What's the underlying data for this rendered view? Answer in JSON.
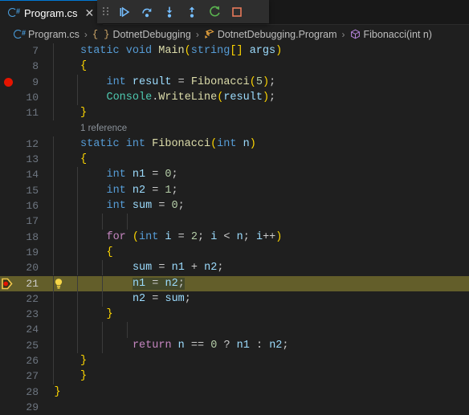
{
  "window": {
    "background": "#1f1f1f",
    "theme": "dark-plus"
  },
  "tab_bar": {
    "active_tab": {
      "label": "Program.cs",
      "icon": "csharp-file-icon",
      "close_label": "✕",
      "accent": "#0078d4"
    }
  },
  "debug_toolbar": {
    "drag_handle": "drag-handle-icon",
    "buttons": [
      {
        "name": "continue",
        "label": "Continue",
        "icon": "play-icon",
        "color": "#75beff"
      },
      {
        "name": "step-over",
        "label": "Step Over",
        "icon": "step-over-arc-icon",
        "color": "#75beff"
      },
      {
        "name": "step-into",
        "label": "Step Into",
        "icon": "step-into-down-arrow-icon",
        "color": "#75beff"
      },
      {
        "name": "step-out",
        "label": "Step Out",
        "icon": "step-out-up-arrow-icon",
        "color": "#75beff"
      },
      {
        "name": "restart",
        "label": "Restart",
        "icon": "restart-circular-arrow-icon",
        "color": "#5bb450"
      },
      {
        "name": "stop",
        "label": "Stop",
        "icon": "stop-square-icon",
        "color": "#e8795a"
      }
    ]
  },
  "breadcrumb": {
    "separator": "›",
    "items": [
      {
        "label": "Program.cs",
        "icon": "csharp-file-icon"
      },
      {
        "label": "DotnetDebugging",
        "icon": "namespace-braces-icon"
      },
      {
        "label": "DotnetDebugging.Program",
        "icon": "class-icon"
      },
      {
        "label": "Fibonacci(int n)",
        "icon": "method-cube-icon"
      }
    ]
  },
  "editor": {
    "language": "csharp",
    "first_visible_line": 7,
    "last_visible_line": 29,
    "current_execution_line": 21,
    "breakpoint_lines": [
      9,
      21
    ],
    "codelens": {
      "line": 12,
      "text": "1 reference"
    },
    "selection": {
      "line": 21,
      "text": "n1 = n2;"
    },
    "lightbulb_line": 21,
    "lines": [
      {
        "n": 7,
        "text": "    static void Main(string[] args)"
      },
      {
        "n": 8,
        "text": "    {"
      },
      {
        "n": 9,
        "text": "        int result = Fibonacci(5);"
      },
      {
        "n": 10,
        "text": "        Console.WriteLine(result);"
      },
      {
        "n": 11,
        "text": "    }"
      },
      {
        "n": 12,
        "text": "    static int Fibonacci(int n)"
      },
      {
        "n": 13,
        "text": "    {"
      },
      {
        "n": 14,
        "text": "        int n1 = 0;"
      },
      {
        "n": 15,
        "text": "        int n2 = 1;"
      },
      {
        "n": 16,
        "text": "        int sum = 0;"
      },
      {
        "n": 17,
        "text": ""
      },
      {
        "n": 18,
        "text": "        for (int i = 2; i < n; i++)"
      },
      {
        "n": 19,
        "text": "        {"
      },
      {
        "n": 20,
        "text": "            sum = n1 + n2;"
      },
      {
        "n": 21,
        "text": "            n1 = n2;"
      },
      {
        "n": 22,
        "text": "            n2 = sum;"
      },
      {
        "n": 23,
        "text": "        }"
      },
      {
        "n": 24,
        "text": ""
      },
      {
        "n": 25,
        "text": "            return n == 0 ? n1 : n2;"
      },
      {
        "n": 26,
        "text": "    }"
      },
      {
        "n": 27,
        "text": "    }"
      },
      {
        "n": 28,
        "text": "}"
      },
      {
        "n": 29,
        "text": ""
      }
    ],
    "colors": {
      "keyword": "#569cd6",
      "control_keyword": "#c586c0",
      "method": "#dcdcaa",
      "type": "#4ec9b0",
      "variable": "#9cdcfe",
      "number": "#b5cea8",
      "punctuation": "#cccccc",
      "line_number": "#6e7681",
      "current_line_bg": "#635e2a",
      "breakpoint": "#e51400",
      "codelens": "#8a9199",
      "indent_guide": "#3b3b3b"
    }
  }
}
